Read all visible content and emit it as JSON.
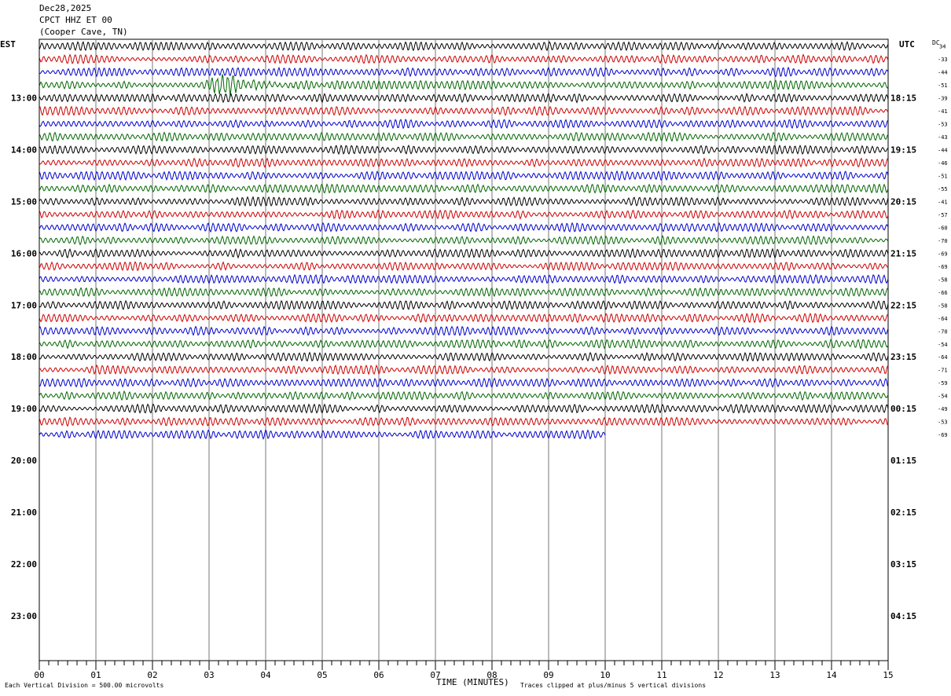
{
  "header": {
    "date": "Dec28,2025",
    "station": "CPCT HHZ ET 00",
    "location": "(Cooper Cave, TN)"
  },
  "left_axis_label": "EST",
  "right_axis_label": "UTC",
  "dc_label": "DC",
  "x_axis_title": "TIME (MINUTES)",
  "footer": {
    "scale_note": "Each Vertical Division =  500.00 microvolts",
    "clip_note": "Traces clipped at plus/minus 5 vertical divisions"
  },
  "chart_data": {
    "type": "line",
    "subtype": "helicorder",
    "minutes_per_line": 15,
    "x_ticks": [
      "00",
      "01",
      "02",
      "03",
      "04",
      "05",
      "06",
      "07",
      "08",
      "09",
      "10",
      "11",
      "12",
      "13",
      "14",
      "15"
    ],
    "xlim": [
      0,
      15
    ],
    "est_hour_labels": [
      "13:00",
      "14:00",
      "15:00",
      "16:00",
      "17:00",
      "18:00",
      "19:00",
      "20:00",
      "21:00",
      "22:00",
      "23:00"
    ],
    "utc_hour_labels": [
      "18:15",
      "19:15",
      "20:15",
      "21:15",
      "22:15",
      "23:15",
      "00:15",
      "01:15",
      "02:15",
      "03:15",
      "04:15"
    ],
    "trace_colors": [
      "#000000",
      "#cc0000",
      "#0000cc",
      "#006600"
    ],
    "dc_offsets": [
      34,
      -33,
      -44,
      -51,
      -39,
      -41,
      -53,
      -43,
      -44,
      -46,
      -51,
      -55,
      -41,
      -57,
      -60,
      -70,
      -69,
      -69,
      -58,
      -66,
      -58,
      -64,
      -70,
      -54,
      -64,
      -71,
      -59,
      -54,
      -49,
      -53,
      -69
    ],
    "total_rows": 48,
    "trace_rows_drawn": 31,
    "last_trace_end_minute": 10,
    "event": {
      "row": 3,
      "start_minute": 2.9,
      "end_minute": 4.6
    }
  }
}
